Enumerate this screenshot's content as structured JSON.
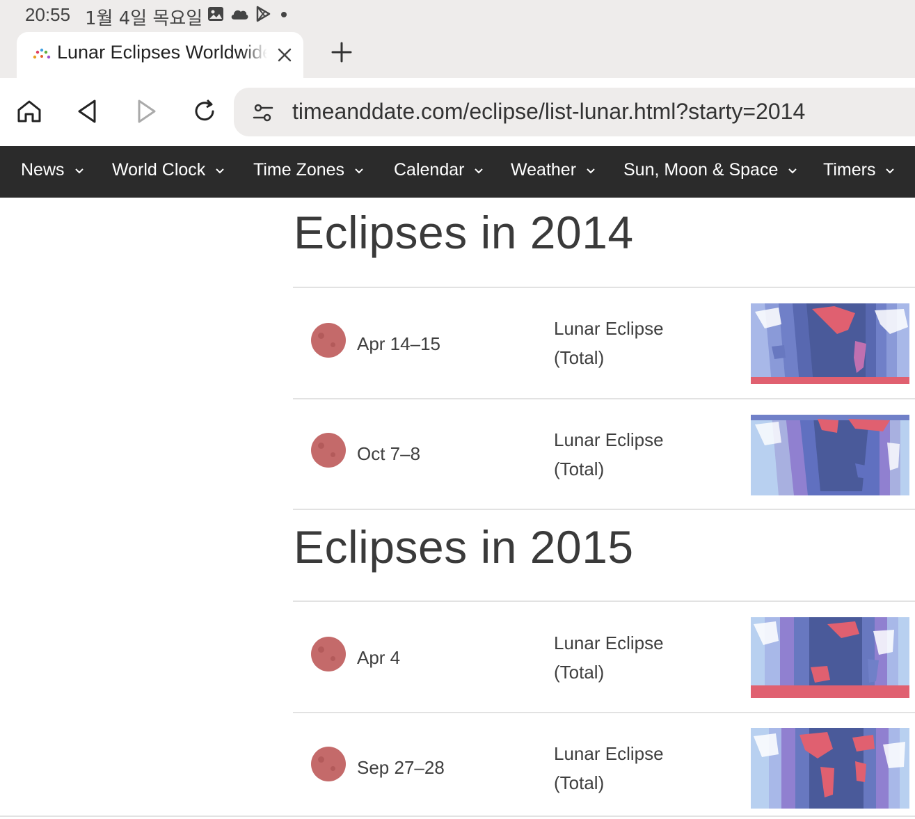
{
  "status_bar": {
    "time": "20:55",
    "date": "1월 4일 목요일",
    "icons": [
      "gallery-icon",
      "cloud-icon",
      "play-store-icon",
      "dot-icon"
    ]
  },
  "tab": {
    "title": "Lunar Eclipses Worldwide",
    "favicon": "timeanddate-favicon"
  },
  "toolbar": {
    "url": "timeanddate.com/eclipse/list-lunar.html?starty=2014",
    "buttons": [
      "home-icon",
      "back-icon",
      "forward-icon",
      "reload-icon",
      "site-settings-icon"
    ]
  },
  "nav": {
    "items": [
      {
        "label": "News"
      },
      {
        "label": "World Clock"
      },
      {
        "label": "Time Zones"
      },
      {
        "label": "Calendar"
      },
      {
        "label": "Weather"
      },
      {
        "label": "Sun, Moon & Space"
      },
      {
        "label": "Timers"
      }
    ]
  },
  "sections": [
    {
      "heading": "Eclipses in 2014",
      "eclipses": [
        {
          "date": "Apr 14–15",
          "type_line1": "Lunar Eclipse",
          "type_line2": "(Total)"
        },
        {
          "date": "Oct 7–8",
          "type_line1": "Lunar Eclipse",
          "type_line2": "(Total)"
        }
      ]
    },
    {
      "heading": "Eclipses in 2015",
      "eclipses": [
        {
          "date": "Apr 4",
          "type_line1": "Lunar Eclipse",
          "type_line2": "(Total)"
        },
        {
          "date": "Sep 27–28",
          "type_line1": "Lunar Eclipse",
          "type_line2": "(Total)"
        }
      ]
    }
  ],
  "colors": {
    "nav_background": "#2b2b2b",
    "moon": "#c46a6a",
    "map_night": "#4a5a9a",
    "map_visible": "#e06070",
    "map_ocean": "#b8d0f0"
  }
}
